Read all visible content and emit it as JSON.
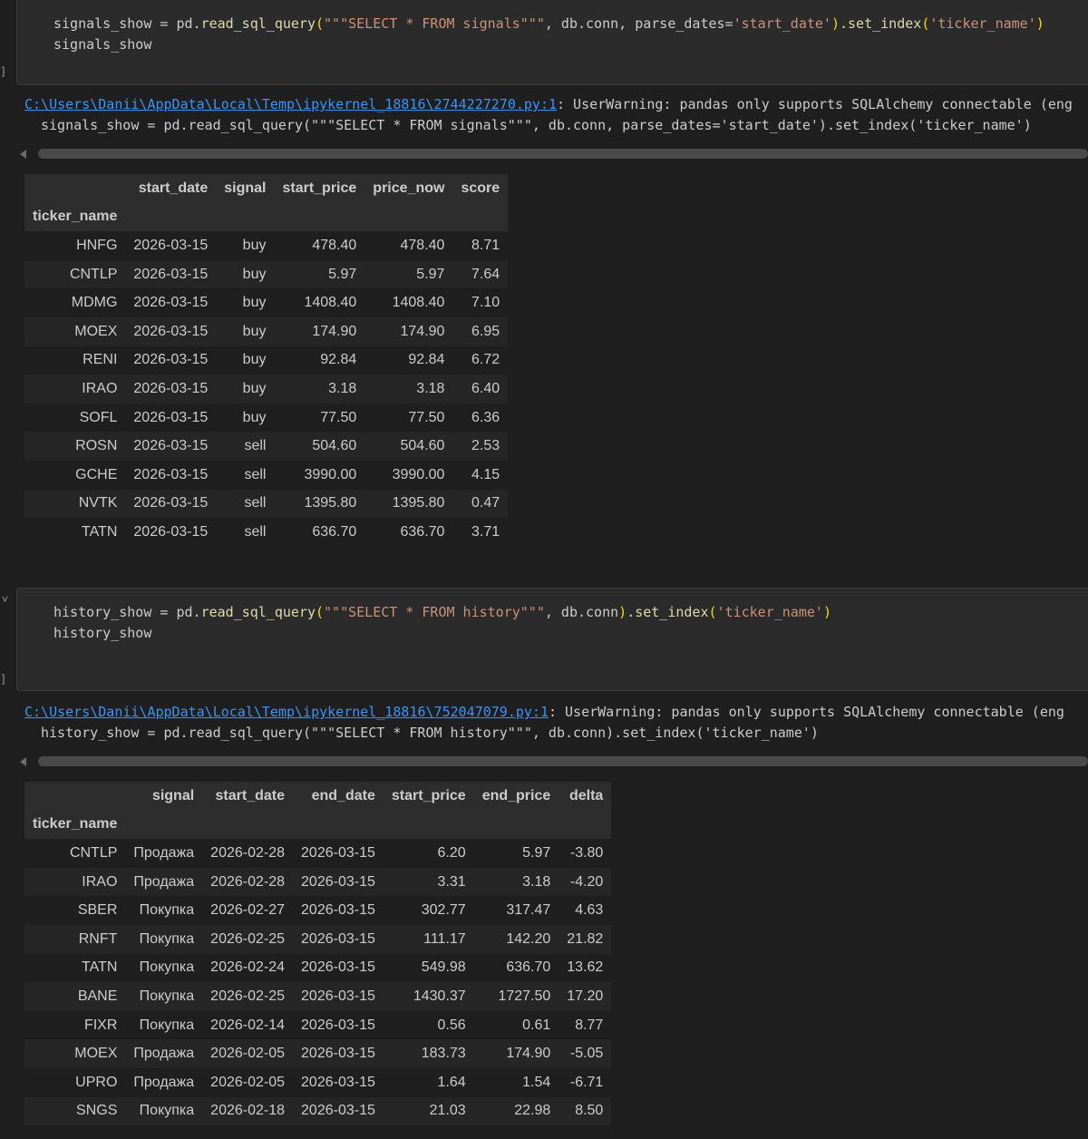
{
  "cell1": {
    "exec_count": "]",
    "code": {
      "line1_var": "signals_show = pd.",
      "line1_fn": "read_sql_query",
      "line1_open": "(",
      "line1_sql": "\"\"\"SELECT * FROM signals\"\"\"",
      "line1_mid": ", db.conn, parse_dates=",
      "line1_str": "'start_date'",
      "line1_close": ")",
      "line1_tail": ".set_index",
      "line1_open2": "(",
      "line1_str2": "'ticker_name'",
      "line1_close2": ")",
      "line2": "signals_show"
    },
    "warning": {
      "link": "C:\\Users\\Danii\\AppData\\Local\\Temp\\ipykernel_18816\\2744227270.py:1",
      "message": ": UserWarning: pandas only supports SQLAlchemy connectable (eng",
      "code_line": "signals_show = pd.read_sql_query(\"\"\"SELECT * FROM signals\"\"\", db.conn, parse_dates='start_date').set_index('ticker_name')"
    },
    "table": {
      "index_name": "ticker_name",
      "columns": [
        "start_date",
        "signal",
        "start_price",
        "price_now",
        "score"
      ],
      "rows": [
        [
          "HNFG",
          "2026-03-15",
          "buy",
          "478.40",
          "478.40",
          "8.71"
        ],
        [
          "CNTLP",
          "2026-03-15",
          "buy",
          "5.97",
          "5.97",
          "7.64"
        ],
        [
          "MDMG",
          "2026-03-15",
          "buy",
          "1408.40",
          "1408.40",
          "7.10"
        ],
        [
          "MOEX",
          "2026-03-15",
          "buy",
          "174.90",
          "174.90",
          "6.95"
        ],
        [
          "RENI",
          "2026-03-15",
          "buy",
          "92.84",
          "92.84",
          "6.72"
        ],
        [
          "IRAO",
          "2026-03-15",
          "buy",
          "3.18",
          "3.18",
          "6.40"
        ],
        [
          "SOFL",
          "2026-03-15",
          "buy",
          "77.50",
          "77.50",
          "6.36"
        ],
        [
          "ROSN",
          "2026-03-15",
          "sell",
          "504.60",
          "504.60",
          "2.53"
        ],
        [
          "GCHE",
          "2026-03-15",
          "sell",
          "3990.00",
          "3990.00",
          "4.15"
        ],
        [
          "NVTK",
          "2026-03-15",
          "sell",
          "1395.80",
          "1395.80",
          "0.47"
        ],
        [
          "TATN",
          "2026-03-15",
          "sell",
          "636.70",
          "636.70",
          "3.71"
        ]
      ]
    }
  },
  "cell2": {
    "exec_count": "]",
    "collapse_icon": "˅",
    "code": {
      "line1_var": "history_show = pd.",
      "line1_fn": "read_sql_query",
      "line1_open": "(",
      "line1_sql": "\"\"\"SELECT * FROM history\"\"\"",
      "line1_mid": ", db.conn",
      "line1_close": ")",
      "line1_tail": ".set_index",
      "line1_open2": "(",
      "line1_str2": "'ticker_name'",
      "line1_close2": ")",
      "line2": "history_show"
    },
    "warning": {
      "link": "C:\\Users\\Danii\\AppData\\Local\\Temp\\ipykernel_18816\\752047079.py:1",
      "message": ": UserWarning: pandas only supports SQLAlchemy connectable (eng",
      "code_line": "history_show = pd.read_sql_query(\"\"\"SELECT * FROM history\"\"\", db.conn).set_index('ticker_name')"
    },
    "table": {
      "index_name": "ticker_name",
      "columns": [
        "signal",
        "start_date",
        "end_date",
        "start_price",
        "end_price",
        "delta"
      ],
      "rows": [
        [
          "CNTLP",
          "Продажа",
          "2026-02-28",
          "2026-03-15",
          "6.20",
          "5.97",
          "-3.80"
        ],
        [
          "IRAO",
          "Продажа",
          "2026-02-28",
          "2026-03-15",
          "3.31",
          "3.18",
          "-4.20"
        ],
        [
          "SBER",
          "Покупка",
          "2026-02-27",
          "2026-03-15",
          "302.77",
          "317.47",
          "4.63"
        ],
        [
          "RNFT",
          "Покупка",
          "2026-02-25",
          "2026-03-15",
          "111.17",
          "142.20",
          "21.82"
        ],
        [
          "TATN",
          "Покупка",
          "2026-02-24",
          "2026-03-15",
          "549.98",
          "636.70",
          "13.62"
        ],
        [
          "BANE",
          "Покупка",
          "2026-02-25",
          "2026-03-15",
          "1430.37",
          "1727.50",
          "17.20"
        ],
        [
          "FIXR",
          "Покупка",
          "2026-02-14",
          "2026-03-15",
          "0.56",
          "0.61",
          "8.77"
        ],
        [
          "MOEX",
          "Продажа",
          "2026-02-05",
          "2026-03-15",
          "183.73",
          "174.90",
          "-5.05"
        ],
        [
          "UPRO",
          "Продажа",
          "2026-02-05",
          "2026-03-15",
          "1.64",
          "1.54",
          "-6.71"
        ],
        [
          "SNGS",
          "Покупка",
          "2026-02-18",
          "2026-03-15",
          "21.03",
          "22.98",
          "8.50"
        ]
      ]
    }
  }
}
